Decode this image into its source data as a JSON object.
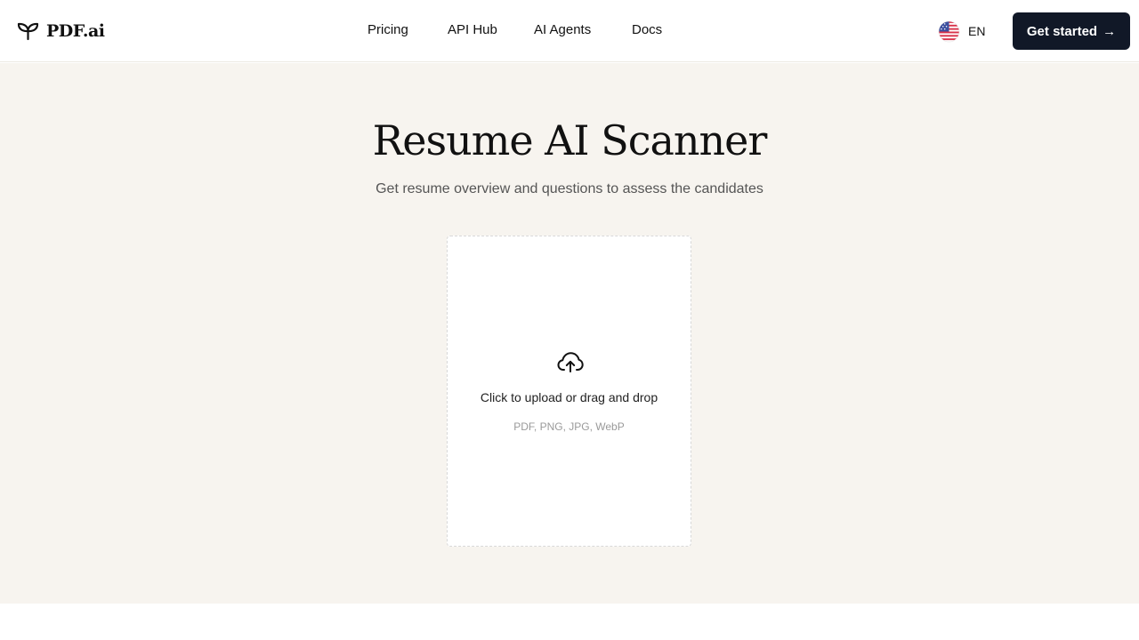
{
  "header": {
    "logo_text": "PDF.ai",
    "nav": [
      {
        "label": "Pricing"
      },
      {
        "label": "API Hub"
      },
      {
        "label": "AI Agents"
      },
      {
        "label": "Docs"
      }
    ],
    "language": {
      "label": "EN",
      "flag_icon": "us-flag-icon"
    },
    "cta_label": "Get started",
    "cta_arrow": "→"
  },
  "hero": {
    "title": "Resume AI Scanner",
    "subtitle": "Get resume overview and questions to assess the candidates"
  },
  "upload": {
    "icon": "cloud-upload-icon",
    "prompt": "Click to upload or drag and drop",
    "formats": "PDF, PNG, JPG, WebP"
  },
  "colors": {
    "hero_background": "#f7f4ef",
    "cta_background": "#111827",
    "text_primary": "#111111",
    "text_muted": "#555555"
  }
}
